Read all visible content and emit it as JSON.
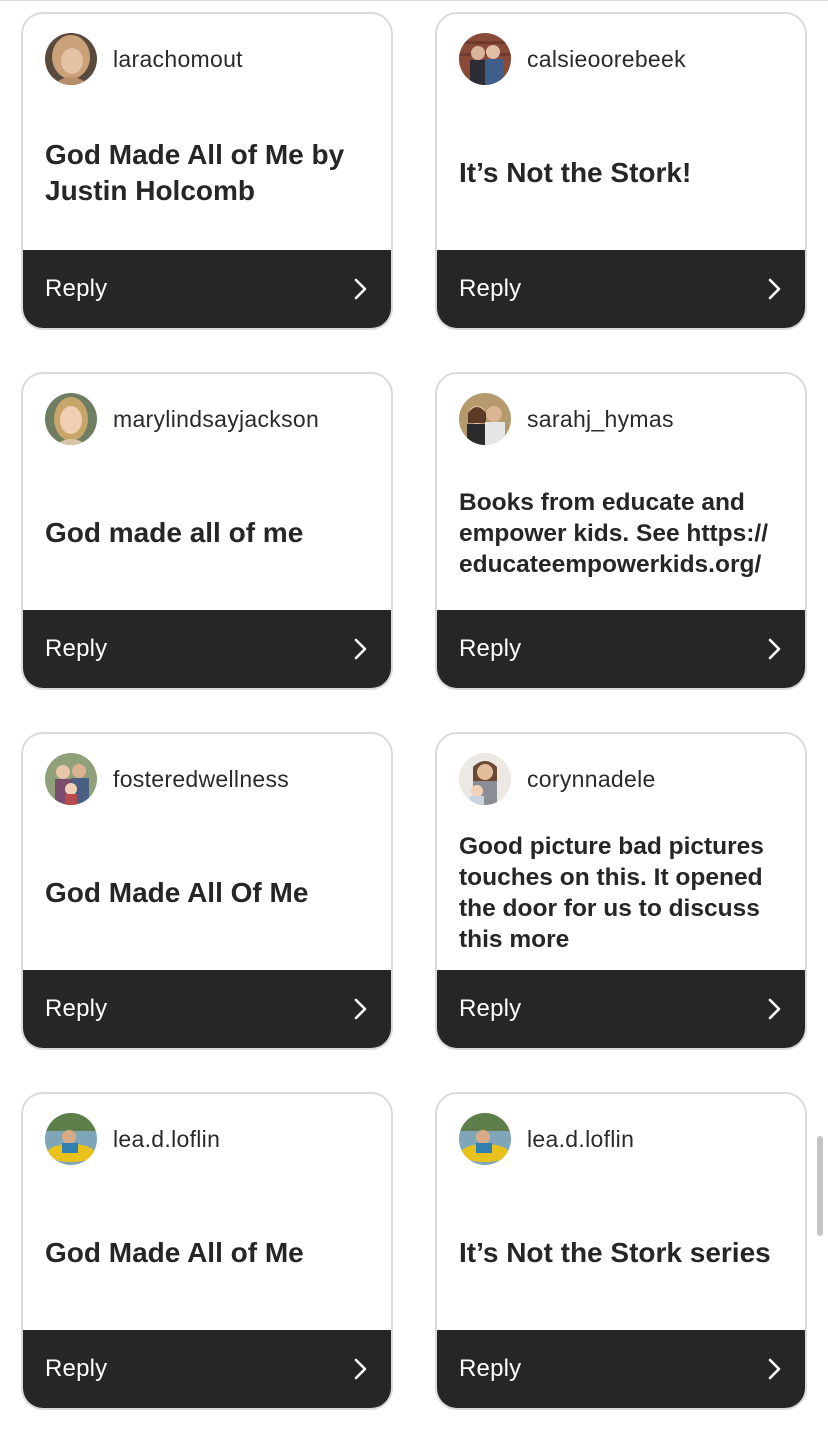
{
  "reply_label": "Reply",
  "chevron_icon": "chevron-right-icon",
  "colors": {
    "card_border": "#dadada",
    "footer_bg": "#262626",
    "text_dark": "#262626"
  },
  "comments": [
    {
      "username": "larachomout",
      "text": "God Made All of Me by Justin Holcomb",
      "avatar": "woman-blonde-avatar"
    },
    {
      "username": "calsieoorebeek",
      "text": "It’s Not the Stork!",
      "avatar": "couple-brick-wall-avatar"
    },
    {
      "username": "marylindsayjackson",
      "text": "God made all of me",
      "avatar": "woman-blonde-outdoor-avatar"
    },
    {
      "username": "sarahj_hymas",
      "text": "Books from educate and empower kids. See https:// educateempowerkids.org/",
      "avatar": "couple-selfie-avatar"
    },
    {
      "username": "fosteredwellness",
      "text": "God Made All Of Me",
      "avatar": "family-outdoor-avatar"
    },
    {
      "username": "corynnadele",
      "text": "Good picture bad pictures touches on this. It opened the door for us to discuss this more",
      "avatar": "mother-child-avatar"
    },
    {
      "username": "lea.d.loflin",
      "text": "God Made All of Me",
      "avatar": "tubing-river-avatar"
    },
    {
      "username": "lea.d.loflin",
      "text": "It’s Not the Stork series",
      "avatar": "tubing-river-avatar"
    }
  ]
}
